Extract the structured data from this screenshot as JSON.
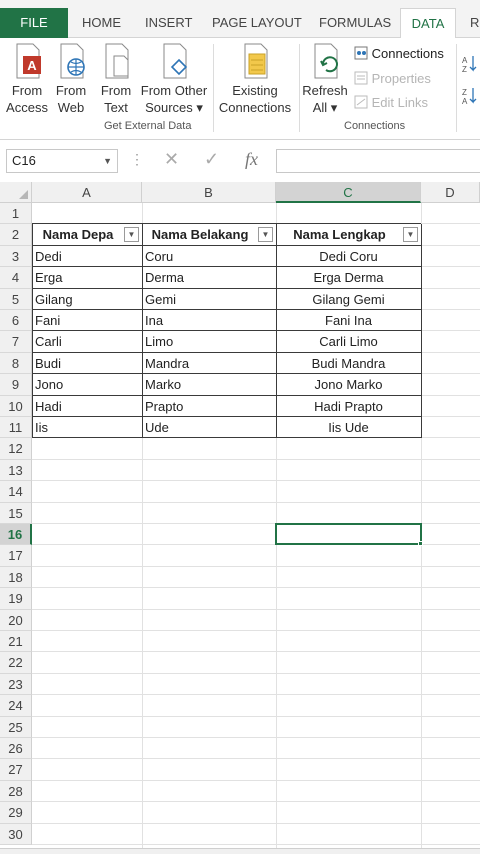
{
  "ribbon_tabs": {
    "file": "FILE",
    "home": "HOME",
    "insert": "INSERT",
    "page_layout": "PAGE LAYOUT",
    "formulas": "FORMULAS",
    "data": "DATA",
    "review_partial": "R"
  },
  "get_external_data": {
    "from_access": [
      "From",
      "Access"
    ],
    "from_web": [
      "From",
      "Web"
    ],
    "from_text": [
      "From",
      "Text"
    ],
    "from_other_sources": [
      "From Other",
      "Sources ▾"
    ],
    "existing_connections": [
      "Existing",
      "Connections"
    ],
    "group_label": "Get External Data"
  },
  "connections_group": {
    "refresh_all": [
      "Refresh",
      "All ▾"
    ],
    "connections": "Connections",
    "properties": "Properties",
    "edit_links": "Edit Links",
    "group_label": "Connections"
  },
  "formula_bar": {
    "name_box": "C16",
    "cancel_symbol": "✕",
    "enter_symbol": "✓",
    "fx_symbol": "fx",
    "formula": ""
  },
  "columns": [
    "A",
    "B",
    "C",
    "D"
  ],
  "rows": [
    "1",
    "2",
    "3",
    "4",
    "5",
    "6",
    "7",
    "8",
    "9",
    "10",
    "11",
    "12",
    "13",
    "14",
    "15",
    "16",
    "17",
    "18",
    "19",
    "20",
    "21",
    "22",
    "23",
    "24",
    "25",
    "26",
    "27",
    "28",
    "29",
    "30"
  ],
  "selected_cell": "C16",
  "table": {
    "headers": [
      "Nama Depa",
      "Nama Belakang",
      "Nama Lengkap"
    ],
    "rows": [
      [
        "Dedi",
        "Coru",
        "Dedi Coru"
      ],
      [
        "Erga",
        "Derma",
        "Erga Derma"
      ],
      [
        "Gilang",
        "Gemi",
        "Gilang Gemi"
      ],
      [
        "Fani",
        "Ina",
        "Fani Ina"
      ],
      [
        "Carli",
        "Limo",
        "Carli Limo"
      ],
      [
        "Budi",
        "Mandra",
        "Budi Mandra"
      ],
      [
        "Jono",
        "Marko",
        "Jono Marko"
      ],
      [
        "Hadi",
        "Prapto",
        "Hadi Prapto"
      ],
      [
        "Iis",
        "Ude",
        "Iis Ude"
      ]
    ]
  },
  "colors": {
    "accent": "#217346",
    "access_red": "#c0392b",
    "web_blue": "#2e75b6"
  }
}
